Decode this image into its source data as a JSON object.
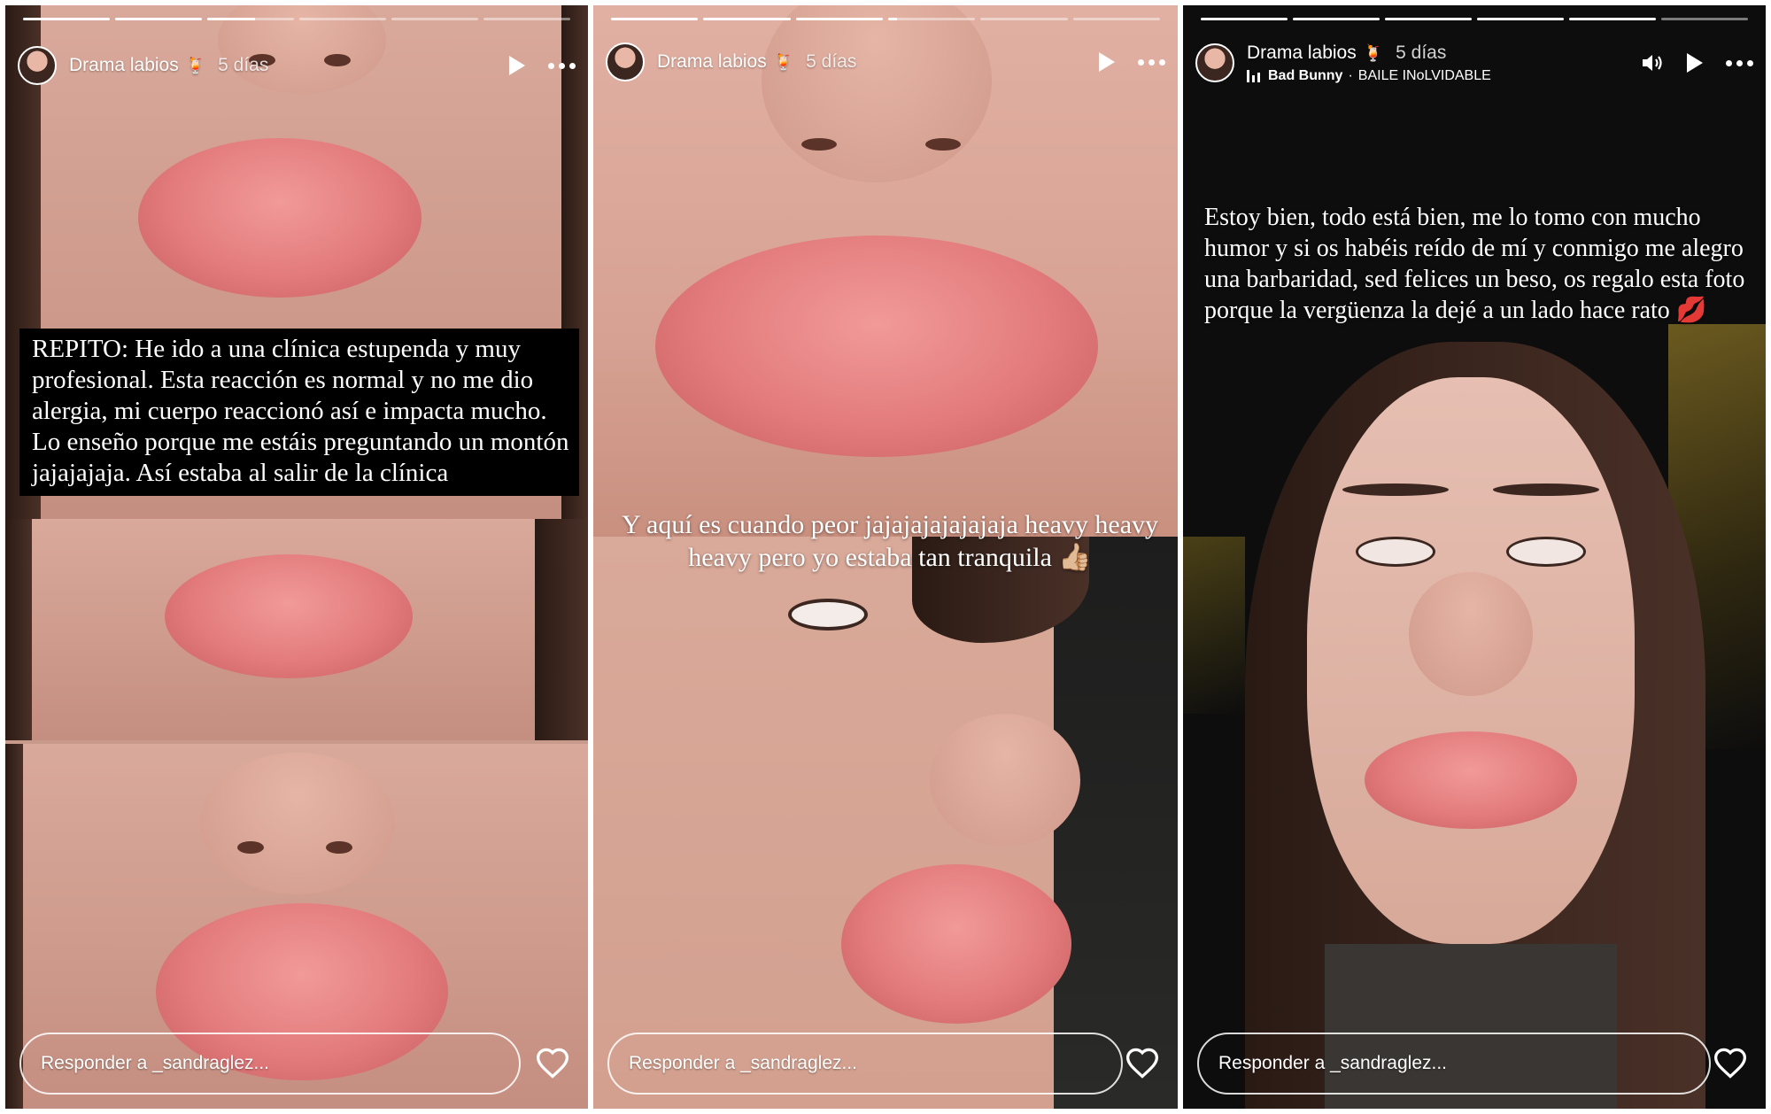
{
  "stories": [
    {
      "username": "Drama labios",
      "emoji": "🍹",
      "time": "5 días",
      "caption": "REPITO: He ido a una clínica estupenda y muy profesional. Esta reacción es normal y no me dio alergia, mi cuerpo reaccionó así e impacta mucho. Lo enseño porque me estáis preguntando un montón jajajajaja. Así estaba al salir de la clínica",
      "reply_placeholder": "Responder a _sandraglez...",
      "progress": [
        1,
        1,
        0.55,
        0,
        0,
        0
      ]
    },
    {
      "username": "Drama labios",
      "emoji": "🍹",
      "time": "5 días",
      "caption": "Y aquí es cuando peor jajajajajajajaja heavy heavy heavy pero yo estaba tan tranquila 👍🏼",
      "reply_placeholder": "Responder a _sandraglez...",
      "progress": [
        1,
        1,
        1,
        0.1,
        0,
        0
      ]
    },
    {
      "username": "Drama labios",
      "emoji": "🍹",
      "time": "5 días",
      "music_artist": "Bad Bunny",
      "music_separator": "·",
      "music_title": "BAILE INoLVIDABLE",
      "caption": "Estoy bien, todo está bien, me lo tomo con mucho humor y si os habéis reído de mí y conmigo me alegro una barbaridad, sed felices un beso, os regalo esta foto porque la vergüenza la dejé a un lado hace rato 💋",
      "reply_placeholder": "Responder a _sandraglez...",
      "progress": [
        1,
        1,
        1,
        1,
        1,
        0
      ]
    }
  ],
  "icons": {
    "play": "play-icon",
    "more": "more-options-icon",
    "volume": "speaker-icon",
    "like": "heart-icon"
  }
}
